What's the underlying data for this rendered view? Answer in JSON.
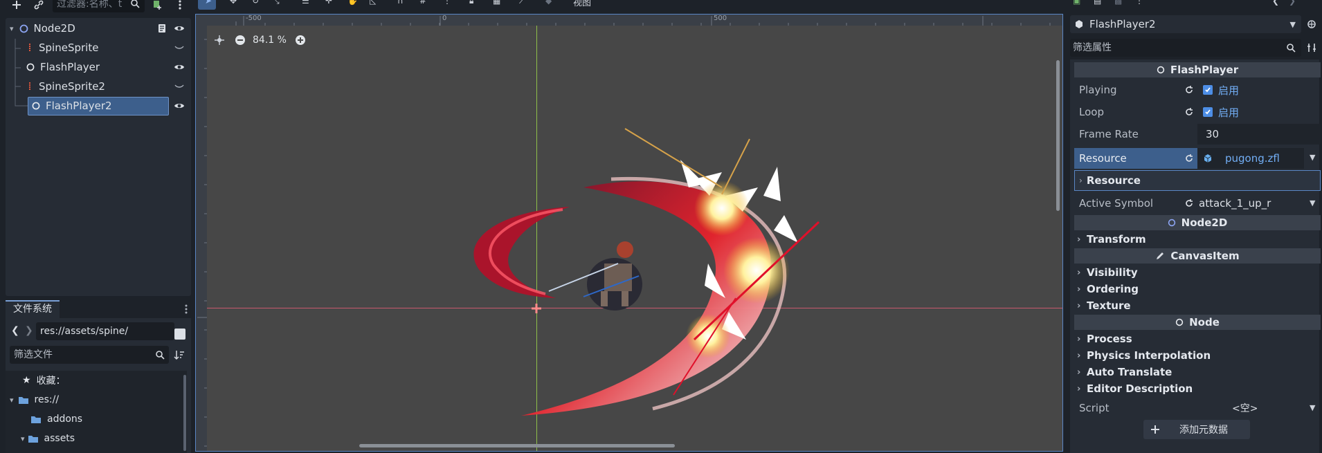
{
  "scene_dock": {
    "filter_placeholder": "过滤器:名称、t",
    "nodes": [
      {
        "label": "Node2D",
        "type": "node2d",
        "indent": 0
      },
      {
        "label": "SpineSprite",
        "type": "spine",
        "indent": 1
      },
      {
        "label": "FlashPlayer",
        "type": "flash",
        "indent": 1
      },
      {
        "label": "SpineSprite2",
        "type": "spine",
        "indent": 1
      },
      {
        "label": "FlashPlayer2",
        "type": "flash",
        "indent": 1,
        "selected": true
      }
    ]
  },
  "filesystem_dock": {
    "tab_label": "文件系统",
    "path": "res://assets/spine/",
    "filter_placeholder": "筛选文件",
    "favorites_label": "收藏：",
    "items": [
      {
        "label": "res://",
        "kind": "folder"
      },
      {
        "label": "addons",
        "kind": "folder"
      },
      {
        "label": "assets",
        "kind": "folder"
      }
    ]
  },
  "viewport": {
    "menu_view": "视图",
    "zoom_text": "84.1 %",
    "ruler_labels": {
      "neg500": "-500",
      "zero": "0",
      "pos500": "500"
    }
  },
  "inspector": {
    "object_name": "FlashPlayer2",
    "filter_placeholder": "筛选属性",
    "sections": {
      "flashplayer": "FlashPlayer",
      "node2d": "Node2D",
      "canvasitem": "CanvasItem",
      "node": "Node"
    },
    "props": {
      "playing_label": "Playing",
      "playing_value": "启用",
      "loop_label": "Loop",
      "loop_value": "启用",
      "frame_rate_label": "Frame Rate",
      "frame_rate_value": "30",
      "resource_label": "Resource",
      "resource_value": "pugong.zfl",
      "resource_sub": "Resource",
      "active_symbol_label": "Active Symbol",
      "active_symbol_value": "attack_1_up_r",
      "script_label": "Script",
      "script_value": "<空>"
    },
    "groups": {
      "transform": "Transform",
      "visibility": "Visibility",
      "ordering": "Ordering",
      "texture": "Texture",
      "process": "Process",
      "physics_interpolation": "Physics Interpolation",
      "auto_translate": "Auto Translate",
      "editor_description": "Editor Description"
    },
    "add_metadata": "添加元数据"
  },
  "colors": {
    "accent": "#4d8ee6",
    "selection": "#3d5f8c",
    "guide_x": "#c85a6e",
    "guide_y": "#8fbf4a"
  }
}
